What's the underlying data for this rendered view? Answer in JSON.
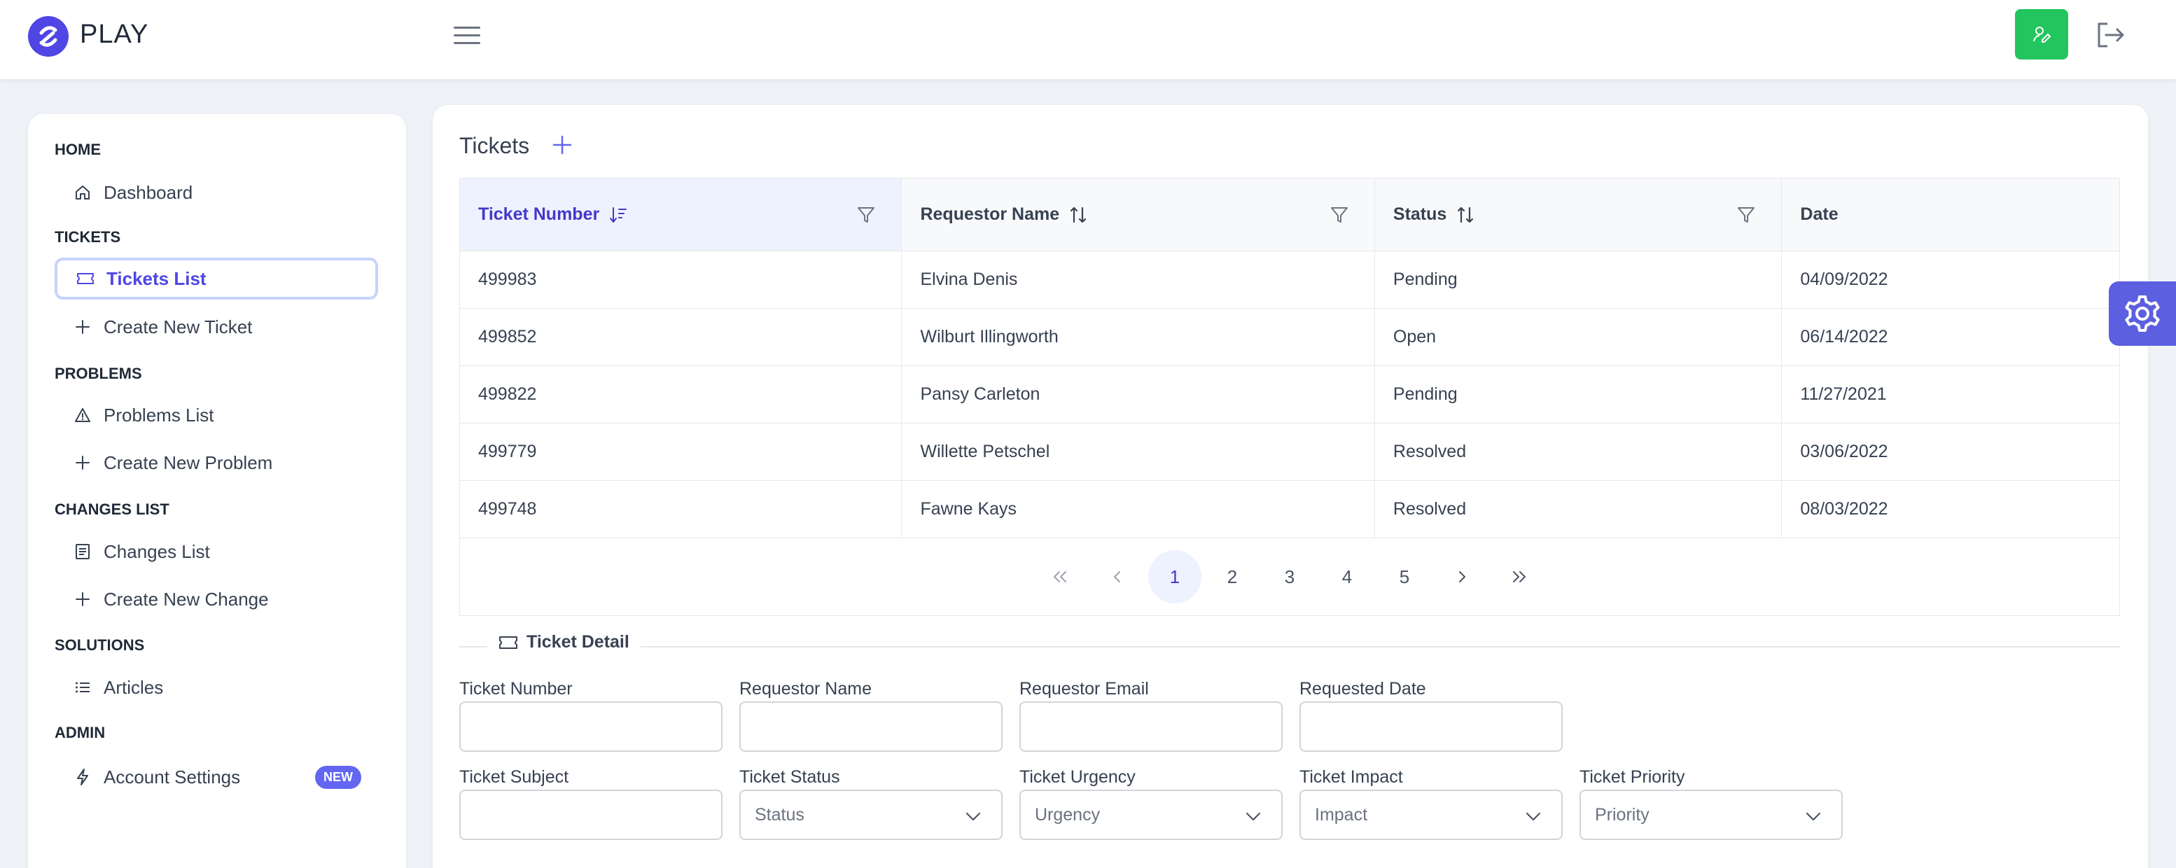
{
  "app": {
    "brand": "PLAY"
  },
  "colors": {
    "accent": "#4f46e5",
    "success": "#22c55e",
    "config": "#5b5fe0"
  },
  "sidebar": {
    "sections": [
      {
        "title": "HOME",
        "items": [
          {
            "label": "Dashboard",
            "icon": "home-icon"
          }
        ]
      },
      {
        "title": "TICKETS",
        "items": [
          {
            "label": "Tickets List",
            "icon": "ticket-icon",
            "active": true
          },
          {
            "label": "Create New Ticket",
            "icon": "plus-icon"
          }
        ]
      },
      {
        "title": "PROBLEMS",
        "items": [
          {
            "label": "Problems List",
            "icon": "warning-icon"
          },
          {
            "label": "Create New Problem",
            "icon": "plus-icon"
          }
        ]
      },
      {
        "title": "CHANGES LIST",
        "items": [
          {
            "label": "Changes List",
            "icon": "document-icon"
          },
          {
            "label": "Create New Change",
            "icon": "plus-icon"
          }
        ]
      },
      {
        "title": "SOLUTIONS",
        "items": [
          {
            "label": "Articles",
            "icon": "list-icon"
          }
        ]
      },
      {
        "title": "ADMIN",
        "items": [
          {
            "label": "Account Settings",
            "icon": "bolt-icon",
            "badge": "NEW"
          }
        ]
      }
    ]
  },
  "main": {
    "title": "Tickets",
    "table": {
      "columns": [
        "Ticket Number",
        "Requestor Name",
        "Status",
        "Date"
      ],
      "rows": [
        [
          "499983",
          "Elvina Denis",
          "Pending",
          "04/09/2022"
        ],
        [
          "499852",
          "Wilburt Illingworth",
          "Open",
          "06/14/2022"
        ],
        [
          "499822",
          "Pansy Carleton",
          "Pending",
          "11/27/2021"
        ],
        [
          "499779",
          "Willette Petschel",
          "Resolved",
          "03/06/2022"
        ],
        [
          "499748",
          "Fawne Kays",
          "Resolved",
          "08/03/2022"
        ]
      ],
      "pagination": {
        "pages": [
          "1",
          "2",
          "3",
          "4",
          "5"
        ],
        "current": "1"
      }
    },
    "detail": {
      "title": "Ticket Detail",
      "fields": {
        "ticket_number": "Ticket Number",
        "requestor_name": "Requestor Name",
        "requestor_email": "Requestor Email",
        "requested_date": "Requested Date",
        "ticket_subject": "Ticket Subject",
        "ticket_status": "Ticket Status",
        "ticket_urgency": "Ticket Urgency",
        "ticket_impact": "Ticket Impact",
        "ticket_priority": "Ticket Priority"
      },
      "selects": {
        "status": "Status",
        "urgency": "Urgency",
        "impact": "Impact",
        "priority": "Priority"
      }
    }
  }
}
